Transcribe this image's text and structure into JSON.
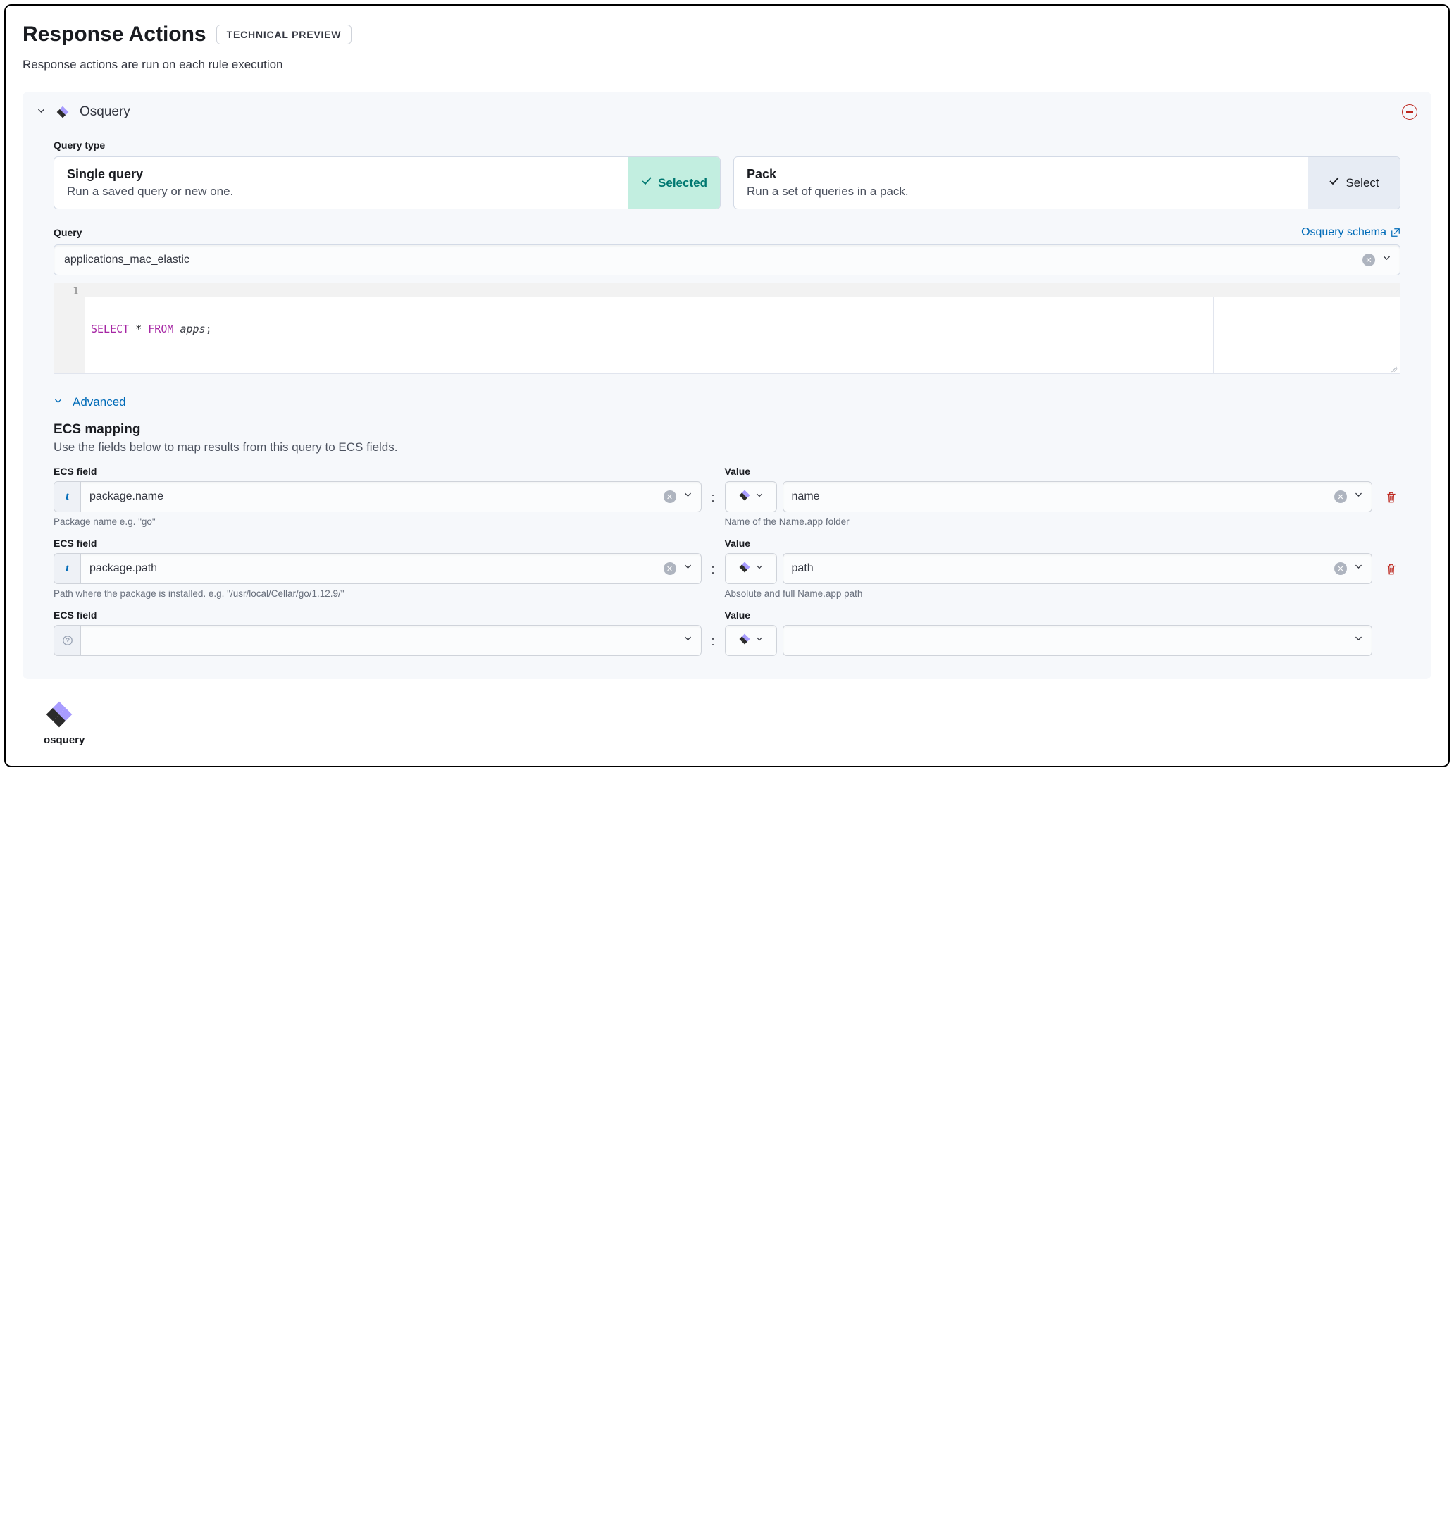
{
  "header": {
    "title": "Response Actions",
    "badge": "TECHNICAL PREVIEW",
    "subtitle": "Response actions are run on each rule execution"
  },
  "panel": {
    "title": "Osquery"
  },
  "query_type": {
    "label": "Query type",
    "options": [
      {
        "title": "Single query",
        "desc": "Run a saved query or new one.",
        "selected_label": "Selected",
        "selected": true
      },
      {
        "title": "Pack",
        "desc": "Run a set of queries in a pack.",
        "select_label": "Select",
        "selected": false
      }
    ]
  },
  "query": {
    "label": "Query",
    "schema_link": "Osquery schema",
    "value": "applications_mac_elastic",
    "code": {
      "line": "1",
      "select": "SELECT",
      "star": " * ",
      "from": "FROM",
      "space": " ",
      "table": "apps",
      "tail": ";"
    }
  },
  "advanced": {
    "label": "Advanced"
  },
  "mapping": {
    "title": "ECS mapping",
    "desc": "Use the fields below to map results from this query to ECS fields.",
    "rows": [
      {
        "ecs_label": "ECS field",
        "ecs_value": "package.name",
        "ecs_helper": "Package name e.g. \"go\"",
        "value_label": "Value",
        "value_value": "name",
        "value_helper": "Name of the Name.app folder",
        "has_delete": true,
        "has_clear": true,
        "prefix_filled": true
      },
      {
        "ecs_label": "ECS field",
        "ecs_value": "package.path",
        "ecs_helper": "Path where the package is installed. e.g. \"/usr/local/Cellar/go/1.12.9/\"",
        "value_label": "Value",
        "value_value": "path",
        "value_helper": "Absolute and full Name.app path",
        "has_delete": true,
        "has_clear": true,
        "prefix_filled": true
      },
      {
        "ecs_label": "ECS field",
        "ecs_value": "",
        "ecs_helper": "",
        "value_label": "Value",
        "value_value": "",
        "value_helper": "",
        "has_delete": false,
        "has_clear": false,
        "prefix_filled": false
      }
    ]
  },
  "footer": {
    "label": "osquery"
  }
}
